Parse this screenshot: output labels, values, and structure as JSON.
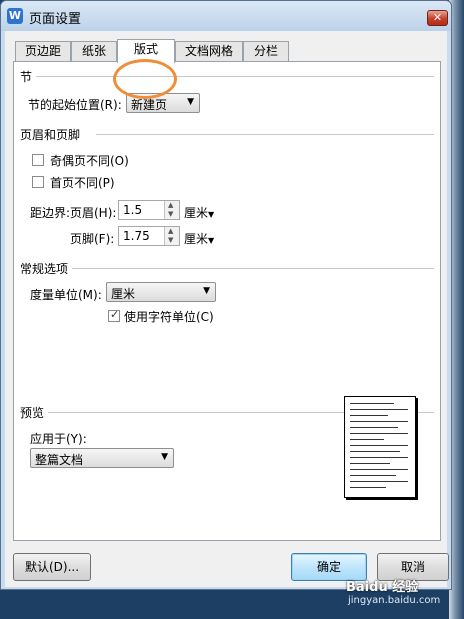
{
  "window": {
    "title": "页面设置",
    "close": "✕"
  },
  "tabs": [
    {
      "label": "页边距"
    },
    {
      "label": "纸张"
    },
    {
      "label": "版式",
      "active": true
    },
    {
      "label": "文档网格"
    },
    {
      "label": "分栏"
    }
  ],
  "section": {
    "heading": "节",
    "start_label": "节的起始位置(R):",
    "start_value": "新建页"
  },
  "header_footer": {
    "heading": "页眉和页脚",
    "odd_even_label": "奇偶页不同(O)",
    "odd_even_checked": false,
    "first_page_label": "首页不同(P)",
    "first_page_checked": false,
    "from_edge_label": "距边界:",
    "header_label": "页眉(H):",
    "header_value": "1.5",
    "header_unit": "厘米",
    "footer_label": "页脚(F):",
    "footer_value": "1.75",
    "footer_unit": "厘米"
  },
  "general": {
    "heading": "常规选项",
    "unit_label": "度量单位(M):",
    "unit_value": "厘米",
    "char_unit_label": "使用字符单位(C)",
    "char_unit_checked": true
  },
  "preview": {
    "heading": "预览",
    "apply_label": "应用于(Y):",
    "apply_value": "整篇文档"
  },
  "buttons": {
    "default": "默认(D)...",
    "ok": "确定",
    "cancel": "取消"
  },
  "watermark": {
    "brand": "Baidu 经验",
    "url": "jingyan.baidu.com"
  },
  "colors": {
    "accent_circle": "#ef8e3a",
    "title_bar": "#c9dbee",
    "ok_button": "#bee6fd"
  }
}
